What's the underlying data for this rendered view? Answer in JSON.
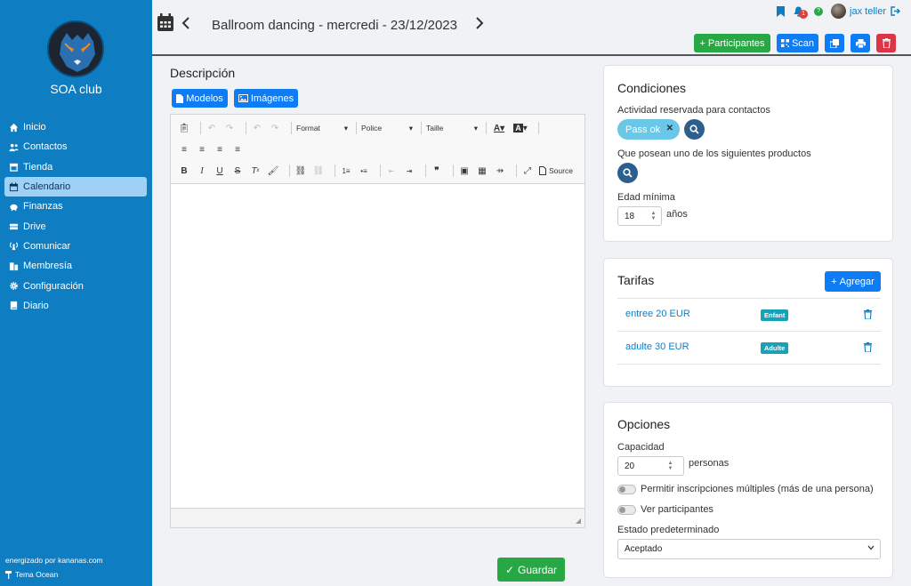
{
  "app": {
    "club_name": "SOA club"
  },
  "sidebar": {
    "items": [
      {
        "label": "Inicio",
        "icon": "home-icon"
      },
      {
        "label": "Contactos",
        "icon": "users-icon"
      },
      {
        "label": "Tienda",
        "icon": "store-icon"
      },
      {
        "label": "Calendario",
        "icon": "calendar-icon",
        "active": true
      },
      {
        "label": "Finanzas",
        "icon": "piggy-bank-icon"
      },
      {
        "label": "Drive",
        "icon": "hdd-icon"
      },
      {
        "label": "Comunicar",
        "icon": "broadcast-icon"
      },
      {
        "label": "Membresía",
        "icon": "id-card-icon"
      },
      {
        "label": "Configuración",
        "icon": "gear-icon"
      },
      {
        "label": "Diario",
        "icon": "book-icon"
      }
    ],
    "footer_powered": "energizado por kananas.com",
    "footer_theme": "Tema Ocean"
  },
  "header": {
    "title": "Ballroom dancing - mercredi - 23/12/2023",
    "notification_count": "1",
    "help_badge": "?",
    "user_name": "jax teller",
    "buttons": {
      "participants": "Participantes",
      "scan": "Scan"
    }
  },
  "description": {
    "title": "Descripción",
    "models_button": "Modelos",
    "images_button": "Imágenes",
    "toolbar": {
      "format": "Format",
      "police": "Police",
      "taille": "Taille",
      "source": "Source"
    }
  },
  "conditions": {
    "title": "Condiciones",
    "reserved_label": "Actividad reservada para contactos",
    "pass_pill": "Pass ok",
    "products_label": "Que posean uno de los siguientes productos",
    "min_age_label": "Edad mínima",
    "min_age_value": "18",
    "years_label": "años"
  },
  "tarifas": {
    "title": "Tarifas",
    "add_button": "Agregar",
    "rows": [
      {
        "label": "entree 20 EUR",
        "tag": "Enfant"
      },
      {
        "label": "adulte 30 EUR",
        "tag": "Adulte"
      }
    ]
  },
  "options": {
    "title": "Opciones",
    "capacity_label": "Capacidad",
    "capacity_value": "20",
    "persons_label": "personas",
    "multi_label": "Permitir inscripciones múltiples (más de una persona)",
    "show_participants_label": "Ver participantes",
    "default_state_label": "Estado predeterminado",
    "default_state_value": "Aceptado"
  },
  "save_button": "Guardar",
  "colors": {
    "sidebar": "#0f7dc2",
    "green": "#28a745",
    "blue": "#0d7cf5",
    "red": "#dc3545",
    "pill": "#6bc7e8"
  }
}
